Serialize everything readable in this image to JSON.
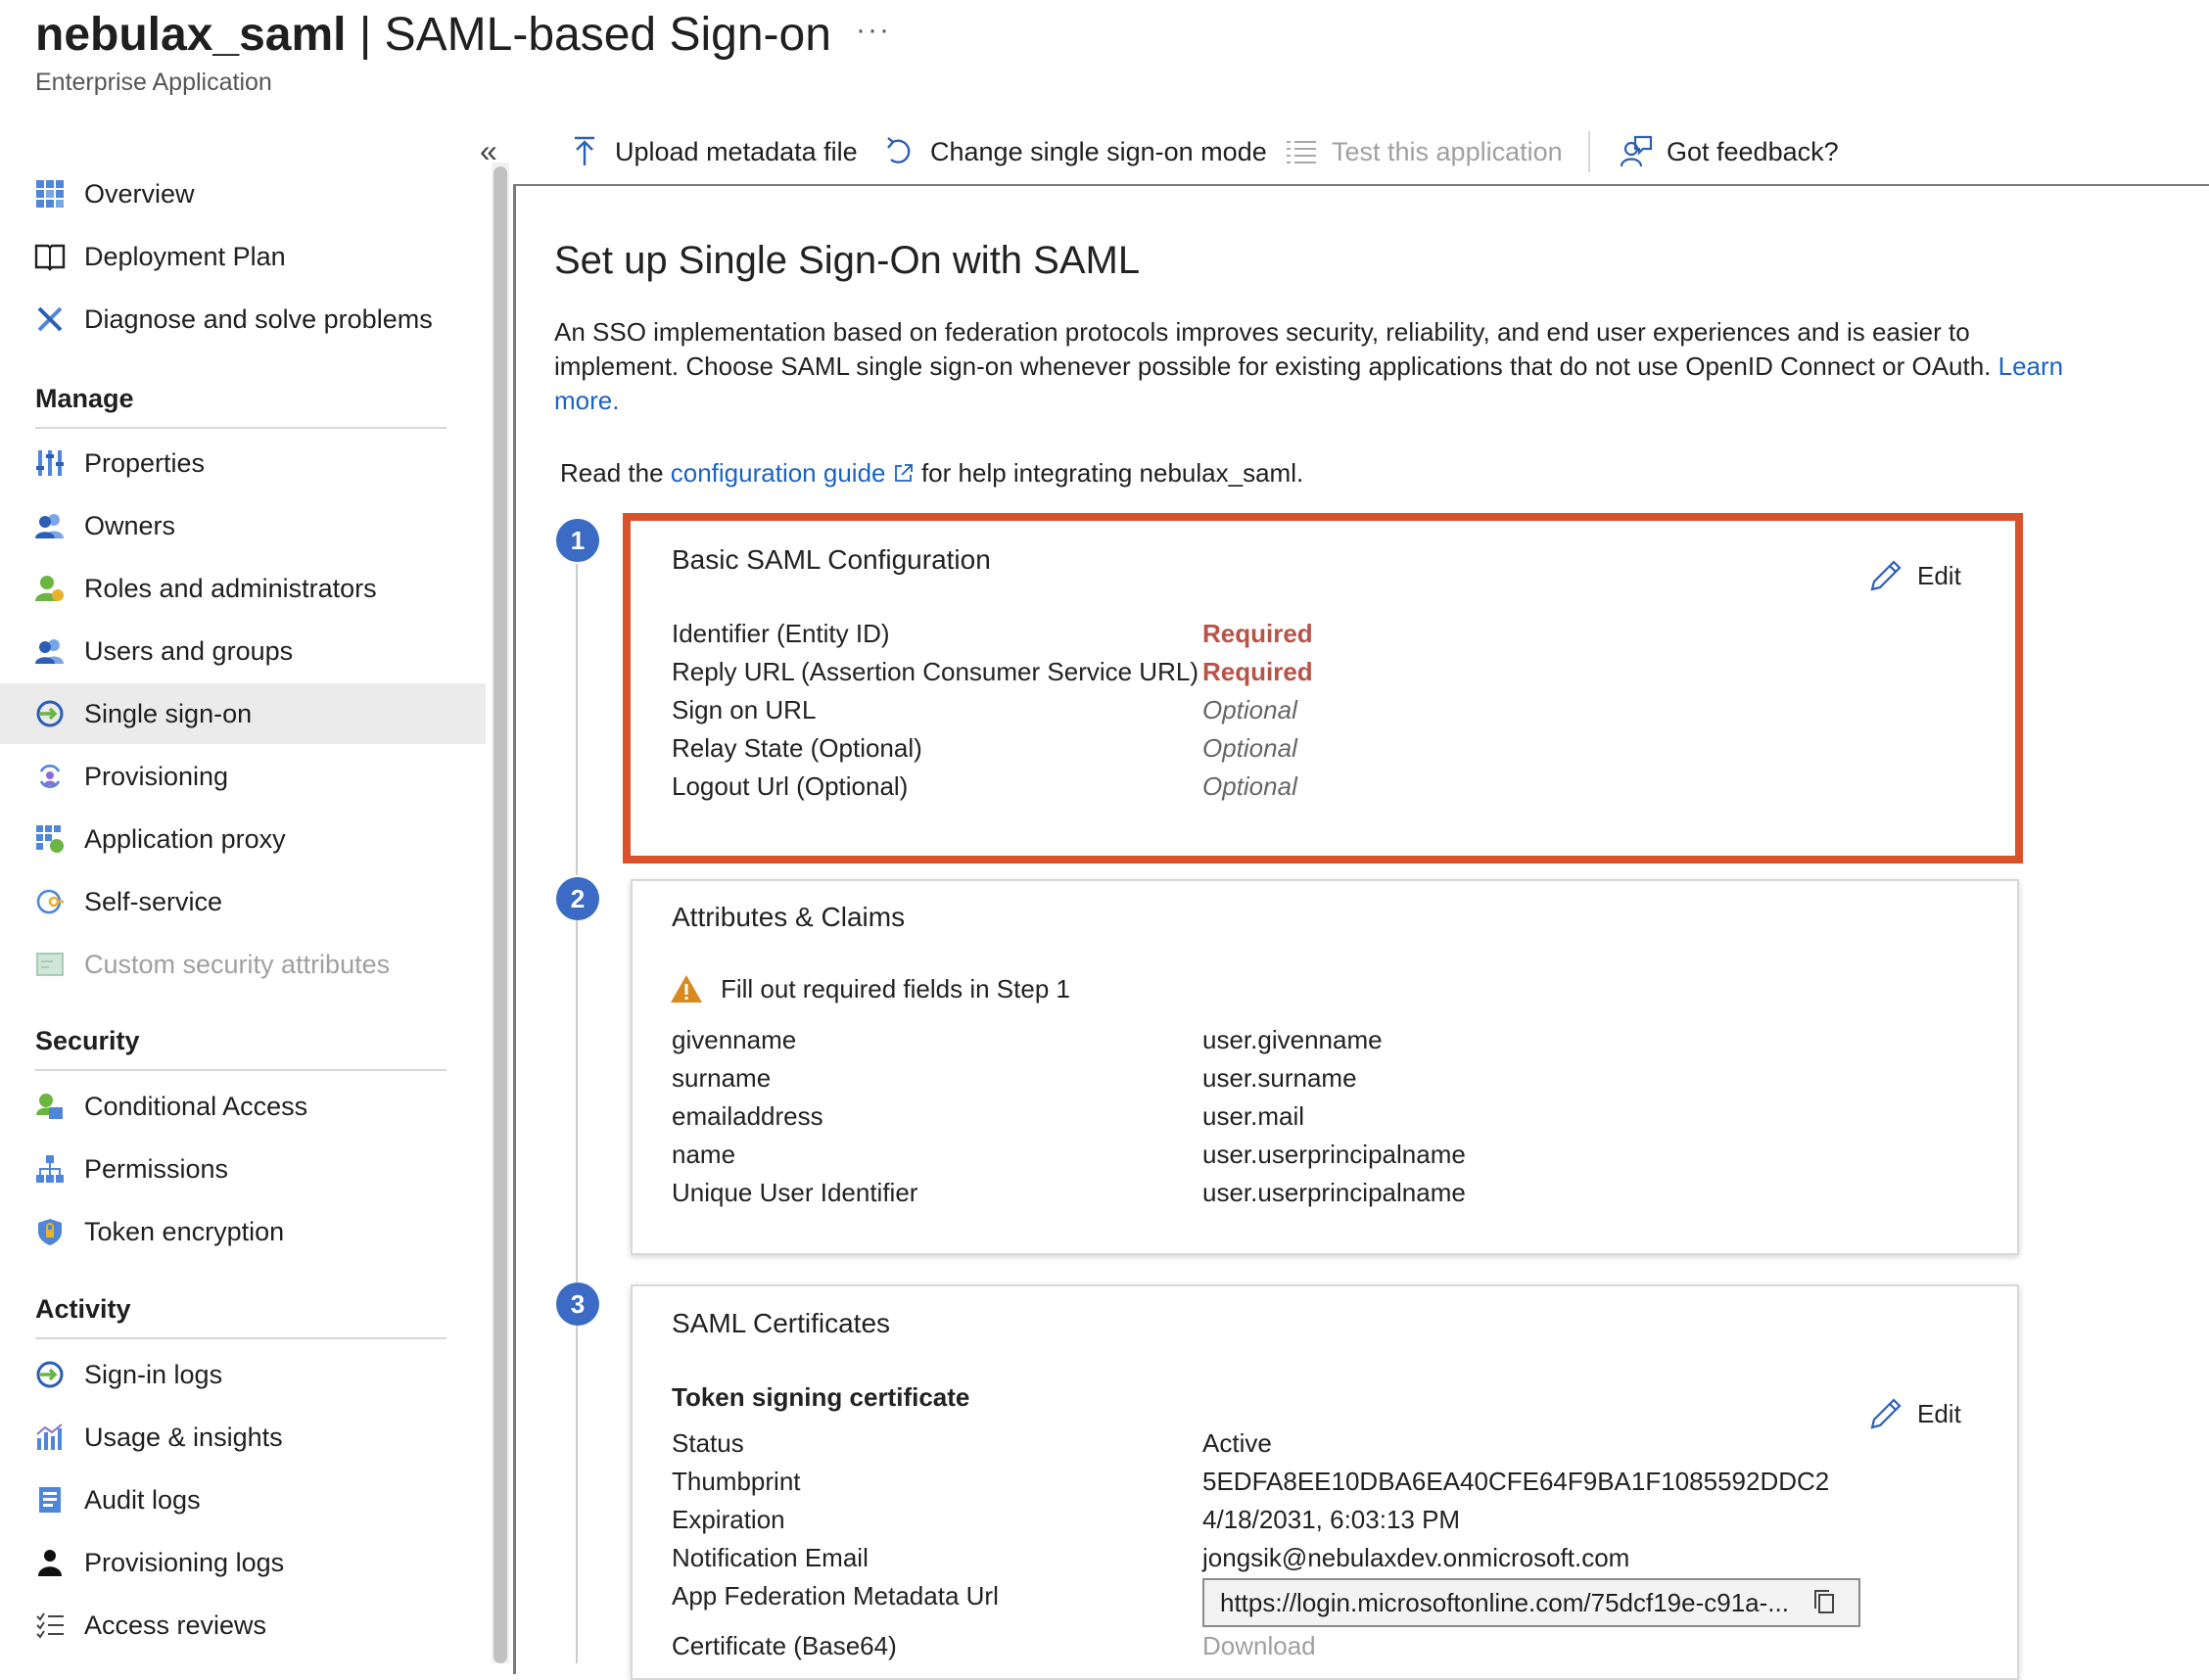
{
  "header": {
    "app_name": "nebulax_saml",
    "separator": "|",
    "page_title": "SAML-based Sign-on",
    "more_label": "···",
    "subtitle": "Enterprise Application"
  },
  "sidebar": {
    "collapse_label": "«",
    "top_items": [
      {
        "label": "Overview",
        "icon": "grid-icon"
      },
      {
        "label": "Deployment Plan",
        "icon": "book-icon"
      },
      {
        "label": "Diagnose and solve problems",
        "icon": "wrench-icon"
      }
    ],
    "sections": [
      {
        "title": "Manage",
        "items": [
          {
            "label": "Properties",
            "icon": "properties-icon"
          },
          {
            "label": "Owners",
            "icon": "people-icon"
          },
          {
            "label": "Roles and administrators",
            "icon": "roles-icon"
          },
          {
            "label": "Users and groups",
            "icon": "people-icon"
          },
          {
            "label": "Single sign-on",
            "icon": "sign-on-icon",
            "selected": true
          },
          {
            "label": "Provisioning",
            "icon": "provisioning-icon"
          },
          {
            "label": "Application proxy",
            "icon": "proxy-icon"
          },
          {
            "label": "Self-service",
            "icon": "self-service-icon"
          },
          {
            "label": "Custom security attributes",
            "icon": "custom-attributes-icon",
            "disabled": true
          }
        ]
      },
      {
        "title": "Security",
        "items": [
          {
            "label": "Conditional Access",
            "icon": "conditional-access-icon"
          },
          {
            "label": "Permissions",
            "icon": "permissions-icon"
          },
          {
            "label": "Token encryption",
            "icon": "shield-icon"
          }
        ]
      },
      {
        "title": "Activity",
        "items": [
          {
            "label": "Sign-in logs",
            "icon": "sign-in-icon"
          },
          {
            "label": "Usage & insights",
            "icon": "chart-icon"
          },
          {
            "label": "Audit logs",
            "icon": "audit-icon"
          },
          {
            "label": "Provisioning logs",
            "icon": "person-icon"
          },
          {
            "label": "Access reviews",
            "icon": "checklist-icon"
          }
        ]
      }
    ]
  },
  "toolbar": {
    "upload": "Upload metadata file",
    "change_mode": "Change single sign-on mode",
    "test": "Test this application",
    "feedback": "Got feedback?"
  },
  "main": {
    "heading": "Set up Single Sign-On with SAML",
    "description": "An SSO implementation based on federation protocols improves security, reliability, and end user experiences and is easier to implement. Choose SAML single sign-on whenever possible for existing applications that do not use OpenID Connect or OAuth.",
    "learn_more": "Learn more.",
    "read_prefix": "Read the",
    "config_guide": "configuration guide",
    "read_suffix": "for help integrating nebulax_saml."
  },
  "steps": {
    "step1": {
      "number": "1",
      "title": "Basic SAML Configuration",
      "edit_label": "Edit",
      "rows": [
        {
          "label": "Identifier (Entity ID)",
          "value": "Required",
          "kind": "req"
        },
        {
          "label": "Reply URL (Assertion Consumer Service URL)",
          "value": "Required",
          "kind": "req"
        },
        {
          "label": "Sign on URL",
          "value": "Optional",
          "kind": "opt"
        },
        {
          "label": "Relay State (Optional)",
          "value": "Optional",
          "kind": "opt"
        },
        {
          "label": "Logout Url (Optional)",
          "value": "Optional",
          "kind": "opt"
        }
      ]
    },
    "step2": {
      "number": "2",
      "title": "Attributes & Claims",
      "warning": "Fill out required fields in Step 1",
      "rows": [
        {
          "label": "givenname",
          "value": "user.givenname"
        },
        {
          "label": "surname",
          "value": "user.surname"
        },
        {
          "label": "emailaddress",
          "value": "user.mail"
        },
        {
          "label": "name",
          "value": "user.userprincipalname"
        },
        {
          "label": "Unique User Identifier",
          "value": "user.userprincipalname"
        }
      ]
    },
    "step3": {
      "number": "3",
      "title": "SAML Certificates",
      "subtitle": "Token signing certificate",
      "edit_label": "Edit",
      "rows": [
        {
          "label": "Status",
          "value": "Active"
        },
        {
          "label": "Thumbprint",
          "value": "5EDFA8EE10DBA6EA40CFE64F9BA1F1085592DDC2"
        },
        {
          "label": "Expiration",
          "value": "4/18/2031, 6:03:13 PM"
        },
        {
          "label": "Notification Email",
          "value": "jongsik@nebulaxdev.onmicrosoft.com"
        }
      ],
      "metadata_label": "App Federation Metadata Url",
      "metadata_url": "https://login.microsoftonline.com/75dcf19e-c91a-...",
      "cert_label": "Certificate (Base64)",
      "download_label": "Download"
    }
  },
  "colors": {
    "accent": "#1a63c4",
    "step_circle": "#3b6bc4",
    "highlight_border": "#d9522b",
    "required_text": "#b85347",
    "selected_bg": "#ebebeb"
  }
}
